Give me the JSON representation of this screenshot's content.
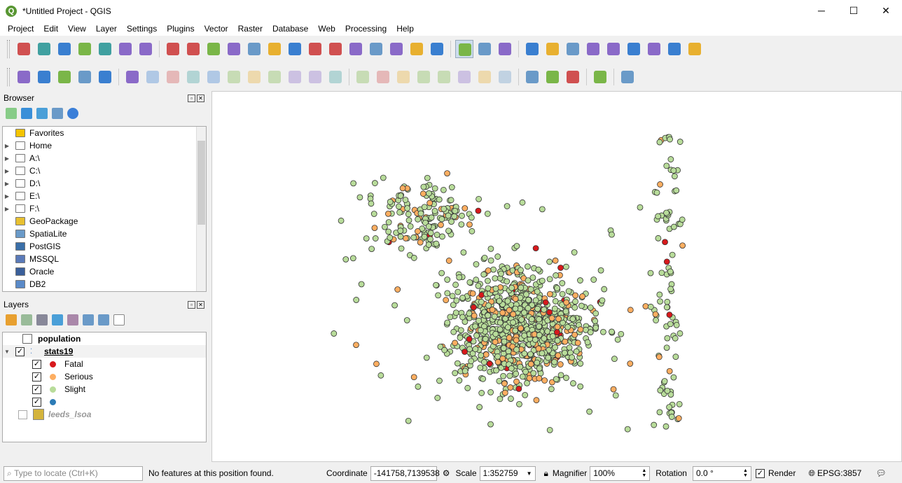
{
  "window": {
    "title": "*Untitled Project - QGIS",
    "minimize": "─",
    "maximize": "☐",
    "close": "✕"
  },
  "menu": [
    "Project",
    "Edit",
    "View",
    "Layer",
    "Settings",
    "Plugins",
    "Vector",
    "Raster",
    "Database",
    "Web",
    "Processing",
    "Help"
  ],
  "toolbar1": [
    "new-project",
    "open-project",
    "save-project",
    "save-as",
    "new-print-layout",
    "layout-manager",
    "style-manager",
    "sep",
    "pan",
    "pan-to-selection",
    "zoom-in",
    "zoom-out",
    "zoom-native",
    "zoom-full",
    "zoom-selection",
    "zoom-layer",
    "zoom-last",
    "zoom-next",
    "new-bookmark",
    "show-bookmarks",
    "spatial-bookmark",
    "refresh",
    "sep",
    "identify",
    "action",
    "select-features",
    "sep",
    "select-by-value",
    "deselect",
    "attribute-table",
    "statistics",
    "field-calculator",
    "sum",
    "measure",
    "map-tips",
    "text-annotation"
  ],
  "toolbar2": [
    "data-source-manager",
    "new-geopackage-layer",
    "digitize-vertex",
    "new-shapefile",
    "new-virtual-layer",
    "sep",
    "current-edits",
    "toggle-editing",
    "save-edits",
    "add-feature",
    "vertex-tool",
    "delete",
    "cut",
    "copy",
    "paste",
    "undo",
    "redo",
    "sep",
    "label-toolbar",
    "layer-diagram",
    "highlight-pinned",
    "pin-labels",
    "show-hide-labels",
    "move-label",
    "rotate-label",
    "change-label",
    "sep",
    "metasearch",
    "wms",
    "wfs",
    "sep",
    "python-console",
    "sep",
    "help"
  ],
  "browser": {
    "title": "Browser",
    "items": [
      {
        "label": "Favorites",
        "icon": "star-icon",
        "expand": false
      },
      {
        "label": "Home",
        "icon": "home-icon",
        "expand": true
      },
      {
        "label": "A:\\",
        "icon": "folder-icon",
        "expand": true
      },
      {
        "label": "C:\\",
        "icon": "folder-icon",
        "expand": true
      },
      {
        "label": "D:\\",
        "icon": "folder-icon",
        "expand": true
      },
      {
        "label": "E:\\",
        "icon": "folder-icon",
        "expand": true
      },
      {
        "label": "F:\\",
        "icon": "folder-icon",
        "expand": true
      },
      {
        "label": "GeoPackage",
        "icon": "geopackage-icon",
        "expand": false
      },
      {
        "label": "SpatiaLite",
        "icon": "spatialite-icon",
        "expand": false
      },
      {
        "label": "PostGIS",
        "icon": "postgis-icon",
        "expand": false
      },
      {
        "label": "MSSQL",
        "icon": "mssql-icon",
        "expand": false
      },
      {
        "label": "Oracle",
        "icon": "oracle-icon",
        "expand": false
      },
      {
        "label": "DB2",
        "icon": "db2-icon",
        "expand": false
      }
    ]
  },
  "layers": {
    "title": "Layers",
    "population": "population",
    "stats19": "stats19",
    "classes": [
      {
        "label": "Fatal",
        "color": "#d7191c"
      },
      {
        "label": "Serious",
        "color": "#fdae61"
      },
      {
        "label": "Slight",
        "color": "#b8dc9a"
      },
      {
        "label": "",
        "color": "#2c7bb6"
      }
    ],
    "leeds": "leeds_lsoa"
  },
  "status": {
    "locate_placeholder": "Type to locate (Ctrl+K)",
    "message": "No features at this position found.",
    "coordinate_label": "Coordinate",
    "coordinate": "-141758,7139538",
    "scale_label": "Scale",
    "scale": "1:352759",
    "magnifier_label": "Magnifier",
    "magnifier": "100%",
    "rotation_label": "Rotation",
    "rotation": "0.0 °",
    "render_label": "Render",
    "crs": "EPSG:3857"
  }
}
